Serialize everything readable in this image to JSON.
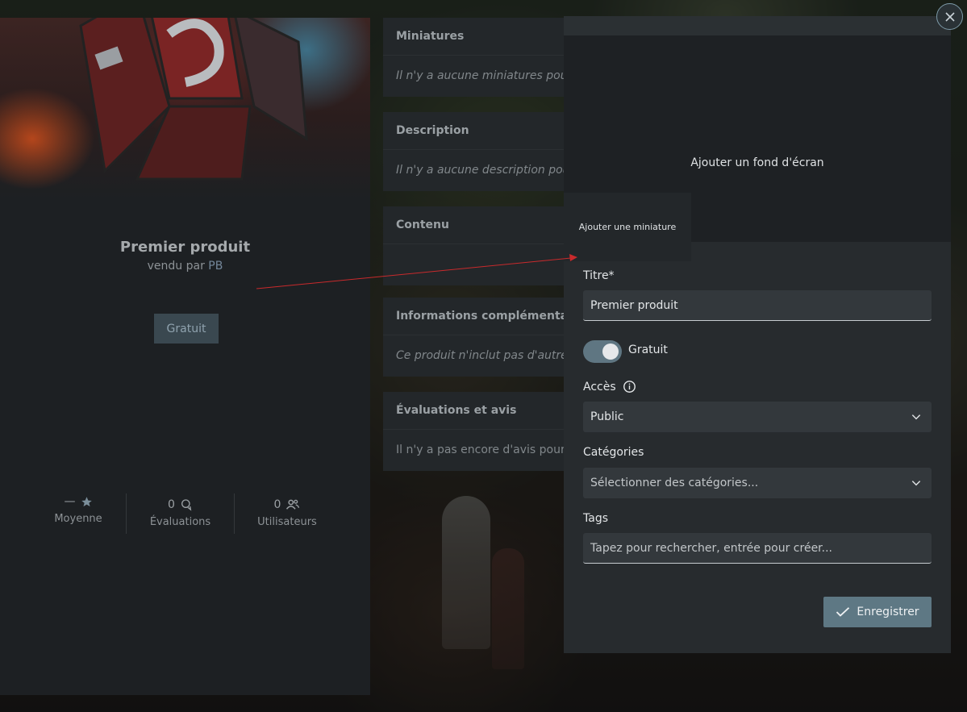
{
  "product": {
    "title": "Premier produit",
    "seller_prefix": "vendu par",
    "seller_name": "PB",
    "price_label": "Gratuit",
    "stats": {
      "rating_value": "—",
      "rating_label": "Moyenne",
      "reviews_value": "0",
      "reviews_label": "Évaluations",
      "users_value": "0",
      "users_label": "Utilisateurs"
    }
  },
  "sections": [
    {
      "title": "Miniatures",
      "body": "Il n'y a aucune miniatures pour l"
    },
    {
      "title": "Description",
      "body": "Il n'y a aucune description pour"
    },
    {
      "title": "Contenu",
      "body": ""
    },
    {
      "title": "Informations complémentaires",
      "body": "Ce produit n'inclut pas d'autre p"
    },
    {
      "title": "Évaluations et avis",
      "body": "Il n'y a pas encore d'avis pour c"
    }
  ],
  "modal": {
    "add_background": "Ajouter un fond d'écran",
    "add_thumbnail": "Ajouter une miniature",
    "title_label": "Titre*",
    "title_value": "Premier produit",
    "free_toggle_label": "Gratuit",
    "free_toggle_on": true,
    "access_label": "Accès",
    "access_value": "Public",
    "categories_label": "Catégories",
    "categories_placeholder": "Sélectionner des catégories...",
    "tags_label": "Tags",
    "tags_placeholder": "Tapez pour rechercher, entrée pour créer...",
    "save_label": "Enregistrer"
  },
  "icons": {
    "close": "close-icon",
    "star": "star-icon",
    "reviews": "chat-bubbles-icon",
    "users": "users-icon",
    "info": "info-icon",
    "chevron": "chevron-down-icon",
    "check": "check-icon"
  },
  "colors": {
    "accent": "#5e7884",
    "annotation_arrow": "#d0282a"
  }
}
